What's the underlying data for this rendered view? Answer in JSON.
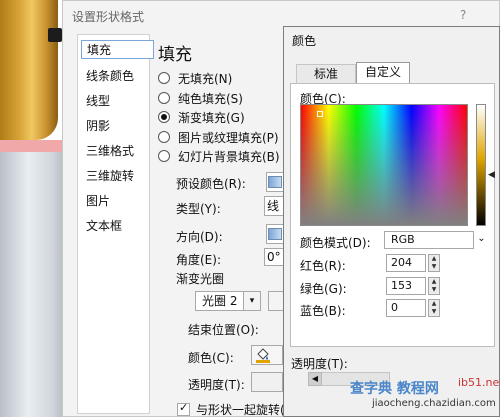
{
  "dialog": {
    "title": "设置形状格式",
    "help": "?"
  },
  "nav": [
    "填充",
    "线条颜色",
    "线型",
    "阴影",
    "三维格式",
    "三维旋转",
    "图片",
    "文本框"
  ],
  "fill": {
    "title": "填充",
    "options": [
      "无填充(N)",
      "纯色填充(S)",
      "渐变填充(G)",
      "图片或纹理填充(P)",
      "幻灯片背景填充(B)"
    ],
    "selected": "渐变填充(G)",
    "preset_label": "预设颜色(R):",
    "type_label": "类型(Y):",
    "type_value": "线",
    "direction_label": "方向(D):",
    "angle_label": "角度(E):",
    "angle_value": "0°",
    "stops_label": "渐变光圈",
    "stop_value": "光圈 2",
    "end_label": "结束位置(O):",
    "color_label": "颜色(C):",
    "transparency_label": "透明度(T):",
    "rotate_label": "与形状一起旋转(W)"
  },
  "color_dialog": {
    "title": "颜色",
    "tab_standard": "标准",
    "tab_custom": "自定义",
    "colors_label": "颜色(C):",
    "model_label": "颜色模式(D):",
    "model_value": "RGB",
    "red_label": "红色(R):",
    "red": "204",
    "green_label": "绿色(G):",
    "green": "153",
    "blue_label": "蓝色(B):",
    "blue": "0",
    "transparency_label": "透明度(T):"
  },
  "watermark": {
    "text": "查字典 教程网",
    "url": "jiaocheng.chazidian.com",
    "site": "ib51.net"
  }
}
